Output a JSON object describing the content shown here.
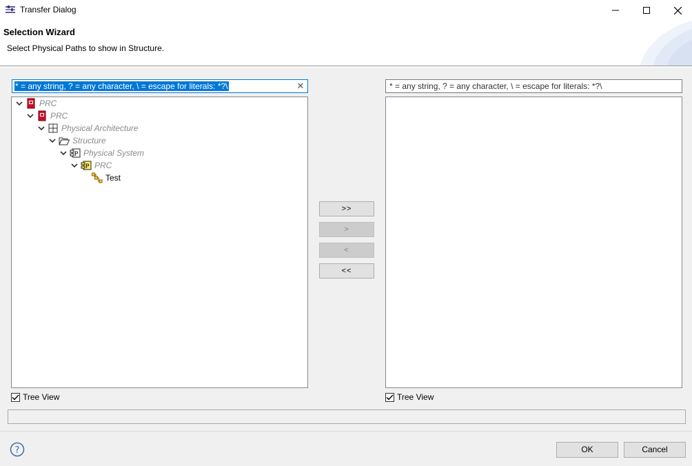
{
  "window": {
    "title": "Transfer Dialog"
  },
  "header": {
    "title": "Selection Wizard",
    "description": "Select Physical Paths to show in Structure."
  },
  "left_panel": {
    "filter_text": "* = any string, ? = any character, \\ = escape for literals: *?\\",
    "tree": [
      {
        "label": "PRC",
        "icon": "red-project-icon",
        "expanded": true,
        "active": false
      },
      {
        "label": "PRC",
        "icon": "red-project-icon",
        "expanded": true,
        "active": false
      },
      {
        "label": "Physical Architecture",
        "icon": "grid-architecture-icon",
        "expanded": true,
        "active": false
      },
      {
        "label": "Structure",
        "icon": "open-folder-icon",
        "expanded": true,
        "active": false
      },
      {
        "label": "Physical System",
        "icon": "physical-component-icon",
        "expanded": true,
        "active": false
      },
      {
        "label": "PRC",
        "icon": "yellow-physical-component-icon",
        "expanded": true,
        "active": false
      },
      {
        "label": "Test",
        "icon": "physical-path-icon",
        "expanded": false,
        "active": true
      }
    ],
    "tree_view_label": "Tree View",
    "tree_view_checked": true
  },
  "right_panel": {
    "filter_placeholder": "* = any string, ? = any character, \\ = escape for literals: *?\\",
    "tree_view_label": "Tree View",
    "tree_view_checked": true
  },
  "transfer_buttons": {
    "add_all": ">>",
    "add": ">",
    "remove": "<",
    "remove_all": "<<"
  },
  "footer": {
    "ok_label": "OK",
    "cancel_label": "Cancel"
  },
  "colors": {
    "selection": "#0078d7",
    "project_red": "#c8102e",
    "component_yellow": "#ffe960"
  }
}
